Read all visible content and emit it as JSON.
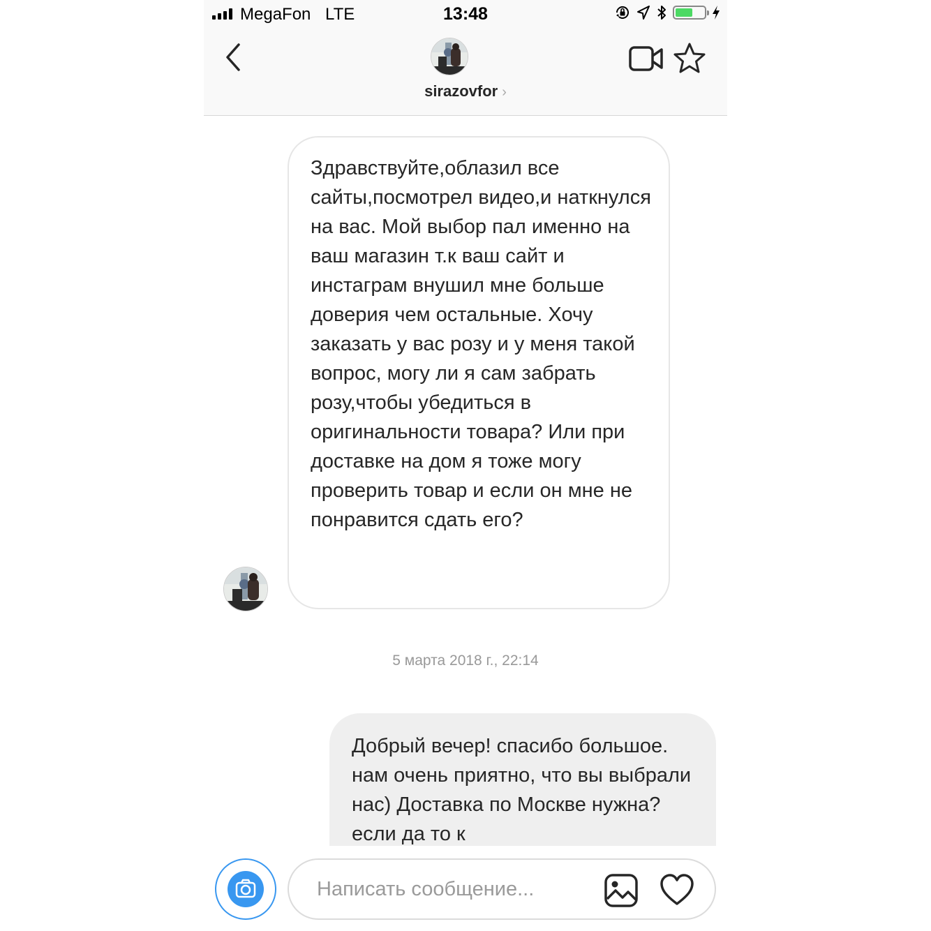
{
  "status_bar": {
    "carrier": "MegaFon",
    "network": "LTE",
    "time": "13:48",
    "icons": [
      "signal-bars-icon",
      "orientation-lock-icon",
      "location-arrow-icon",
      "bluetooth-icon",
      "battery-icon",
      "charging-bolt-icon"
    ],
    "battery_level": 0.55,
    "battery_color": "#4cd964"
  },
  "header": {
    "username": "sirazovfor",
    "chevron": "›",
    "icons": [
      "back-chevron-icon",
      "avatar",
      "video-call-icon",
      "star-icon"
    ]
  },
  "messages": [
    {
      "direction": "incoming",
      "text": "Здравствуйте,облазил все сайты,посмотрел видео,и наткнулся на вас. Мой выбор пал именно на ваш магазин т.к ваш сайт и инстаграм внушил мне больше доверия чем остальные. Хочу заказать у вас розу и у меня такой вопрос, могу ли я сам забрать розу,чтобы убедиться в оригинальности товара? Или при доставке на дом я тоже могу проверить товар и если он мне не понравится сдать его?"
    },
    {
      "direction": "outgoing",
      "text": "Добрый вечер! спасибо большое. нам очень приятно, что вы выбрали нас) Доставка по Москве нужна? если да то к"
    }
  ],
  "timestamp": "5 марта 2018 г., 22:14",
  "composer": {
    "placeholder": "Написать сообщение...",
    "icons": [
      "camera-icon",
      "gallery-icon",
      "heart-icon"
    ],
    "accent": "#3897f0"
  }
}
